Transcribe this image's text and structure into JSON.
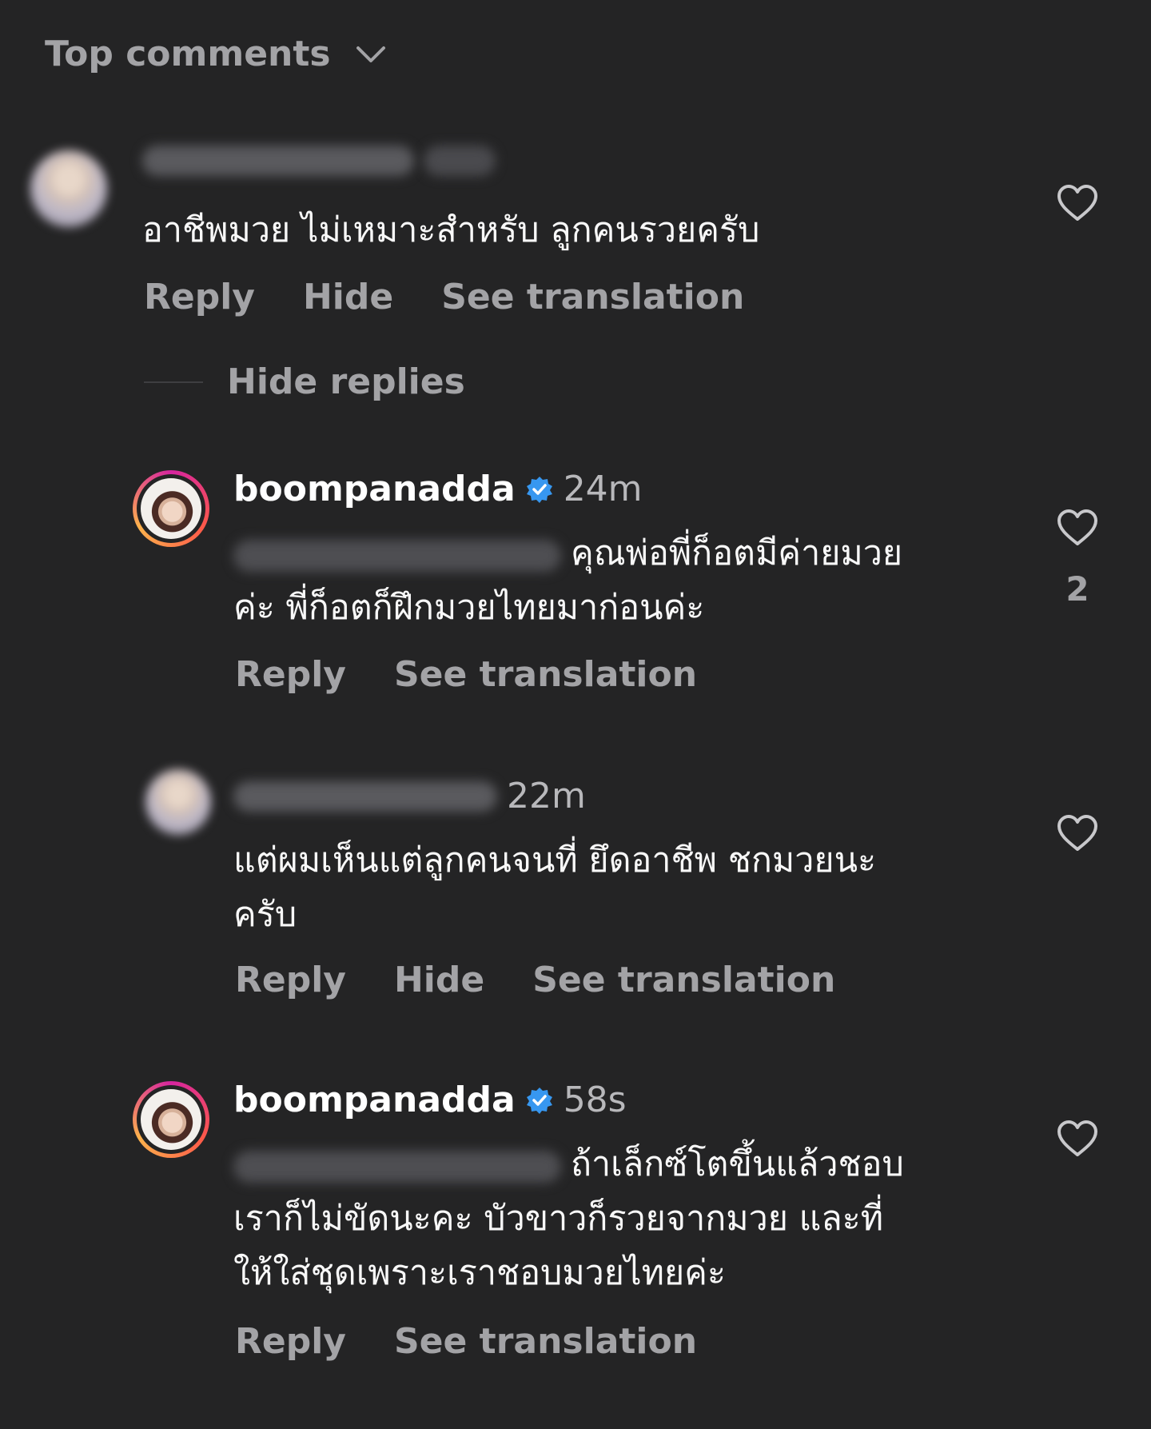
{
  "header": {
    "sort_label": "Top comments",
    "sort_icon": "chevron-down-icon"
  },
  "comments": [
    {
      "time": "",
      "text": "อาชีพมวย ไม่เหมาะสำหรับ ลูกคนรวยครับ",
      "actions": [
        "Reply",
        "Hide",
        "See translation"
      ]
    }
  ],
  "hide_replies_label": "Hide replies",
  "replies": [
    {
      "username": "boompanadda",
      "verified": true,
      "time": "24m",
      "text_line1": "คุณพ่อพี่ก็อตมีค่ายมวย",
      "text_line2": "ค่ะ พี่ก็อตก็ฝึกมวยไทยมาก่อนค่ะ",
      "actions": [
        "Reply",
        "See translation"
      ],
      "like_count": "2"
    },
    {
      "time": "22m",
      "text_line1": "แต่ผมเห็นแต่ลูกคนจนที่ ยึดอาชีพ ชกมวยนะ",
      "text_line2": "ครับ",
      "actions": [
        "Reply",
        "Hide",
        "See translation"
      ]
    },
    {
      "username": "boompanadda",
      "verified": true,
      "time": "58s",
      "text_line1": "ถ้าเล็กซ์โตขึ้นแล้วชอบ",
      "text_line2": "เราก็ไม่ขัดนะคะ บัวขาวก็รวยจากมวย และที่",
      "text_line3": "ให้ใส่ชุดเพราะเราชอบมวยไทยค่ะ",
      "actions": [
        "Reply",
        "See translation"
      ]
    }
  ],
  "colors": {
    "background": "#242425",
    "muted": "#a3a3a6",
    "verified": "#3797f0"
  }
}
